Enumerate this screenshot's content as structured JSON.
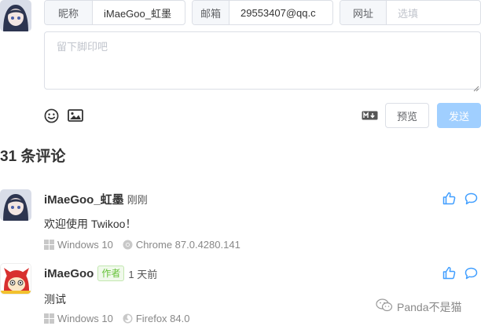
{
  "form": {
    "nickname_label": "昵称",
    "nickname_value": "iMaeGoo_虹墨",
    "email_label": "邮箱",
    "email_value": "29553407@qq.c",
    "website_label": "网址",
    "website_placeholder": "选填",
    "comment_placeholder": "留下脚印吧",
    "preview_label": "预览",
    "send_label": "发送",
    "emoji_icon": "emoji-icon",
    "image_icon": "image-icon",
    "markdown_icon": "markdown-icon",
    "colors": {
      "border": "#dcdfe6",
      "send": "#a0cfff"
    }
  },
  "comments_header": {
    "title": "31 条评论"
  },
  "comments": [
    {
      "nick": "iMaeGoo_虹墨",
      "tag": "",
      "time": "刚刚",
      "content": "欢迎使用 Twikoo！",
      "os": "Windows 10",
      "browser": "Chrome 87.0.4280.141"
    },
    {
      "nick": "iMaeGoo",
      "tag": "作者",
      "time": "1 天前",
      "content": "测试",
      "os": "Windows 10",
      "browser": "Firefox 84.0"
    }
  ],
  "watermark": {
    "text": "Panda不是猫"
  },
  "accent_color": "#409eff"
}
